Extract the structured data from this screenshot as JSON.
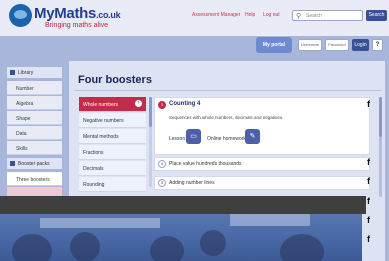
{
  "header": {
    "logo_title": "MyMaths",
    "logo_domain": ".co.uk",
    "tagline": "Bringing maths alive",
    "links": [
      "Assessment Manager",
      "Help",
      "Log out"
    ],
    "search_placeholder": "Search",
    "search_button": "Search"
  },
  "portal": {
    "label": "My portal",
    "username": "Username",
    "password": "Password",
    "login": "Login",
    "help": "?"
  },
  "sidebar": {
    "library_label": "Library",
    "library_items": [
      "Number",
      "Algebra",
      "Shape",
      "Data",
      "Skills"
    ],
    "booster_label": "Booster packs",
    "booster_items": [
      "Three boosters"
    ]
  },
  "main": {
    "title": "Four boosters",
    "list": [
      "Whole numbers",
      "Negative numbers",
      "Mental methods",
      "Fractions",
      "Decimals",
      "Rounding"
    ],
    "detail": {
      "number": "3",
      "title": "Counting 4",
      "description": "Sequences with whole numbers, decimals and negatives.",
      "lesson_label": "Lesson",
      "homework_label": "Online homework"
    },
    "rows": [
      {
        "number": "4",
        "text": "Place value hundreds thousands"
      },
      {
        "number": "3",
        "text": "Adding number lines"
      }
    ],
    "f_icon": "f"
  }
}
